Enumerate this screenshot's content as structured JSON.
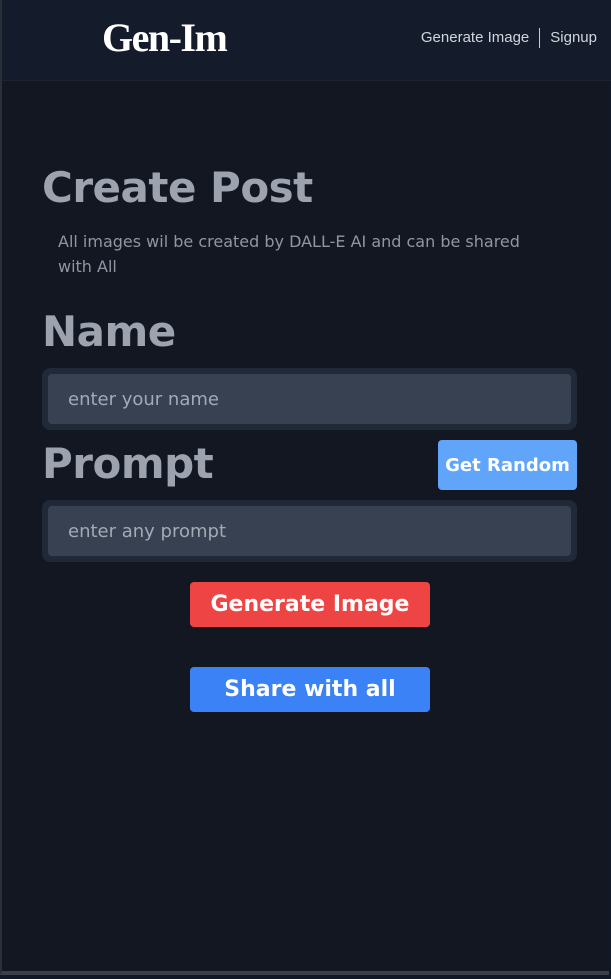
{
  "navbar": {
    "logo": "Gen-Im",
    "links": [
      {
        "label": "Generate Image"
      },
      {
        "label": "Signup"
      }
    ]
  },
  "main": {
    "title": "Create Post",
    "subtitle": "All images wil be created by DALL-E AI and can be shared with All",
    "name_label": "Name",
    "name_placeholder": "enter your name",
    "prompt_label": "Prompt",
    "prompt_placeholder": "enter any prompt",
    "random_button": "Get Random",
    "generate_button": "Generate Image",
    "share_button": "Share with all"
  },
  "colors": {
    "background": "#131722",
    "navbar": "#141c2c",
    "generate": "#ef4444",
    "share": "#3b82f6",
    "random": "#60a5fa"
  }
}
